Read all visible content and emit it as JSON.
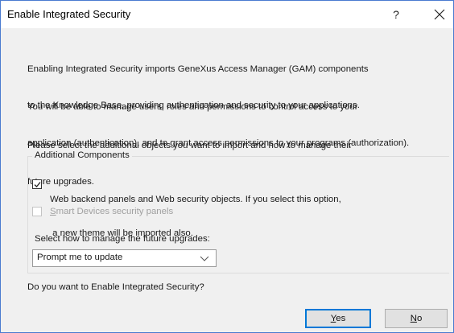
{
  "window": {
    "title": "Enable Integrated Security",
    "help_label": "?",
    "close_icon": "close-icon"
  },
  "intro": {
    "line1": "Enabling Integrated Security imports GeneXus Access Manager (GAM) components",
    "line2": "to the Knowledge Base, providing authentication and security to your applications."
  },
  "manage": {
    "line1": "You will be able to manage users, roles and permissions to control access to your",
    "line2": "application (authentication), and to grant access permissions to your programs (authorization)."
  },
  "select_info": {
    "line1": "Please select the additional objects you want to import and how to manage their",
    "line2": "future upgrades."
  },
  "group": {
    "label": "Additional Components",
    "web_panels": {
      "checked": true,
      "enabled": true,
      "line1": "Web backend panels and Web security objects. If you select this option,",
      "line2": " a new theme will be imported also."
    },
    "smart_devices": {
      "checked": false,
      "enabled": false,
      "mnemonic": "S",
      "rest": "mart Devices security panels"
    },
    "upgrades_label": "Select how to manage the future upgrades:",
    "upgrades_select": {
      "value": "Prompt me to update",
      "icon": "chevron-down-icon"
    }
  },
  "question": "Do you want to Enable Integrated Security?",
  "buttons": {
    "yes": {
      "mnemonic": "Y",
      "rest": "es"
    },
    "no": {
      "mnemonic": "N",
      "rest": "o"
    }
  },
  "colors": {
    "window_border": "#4a7bd0",
    "dialog_bg": "#f0f0f0",
    "default_button_border": "#0078d7"
  }
}
